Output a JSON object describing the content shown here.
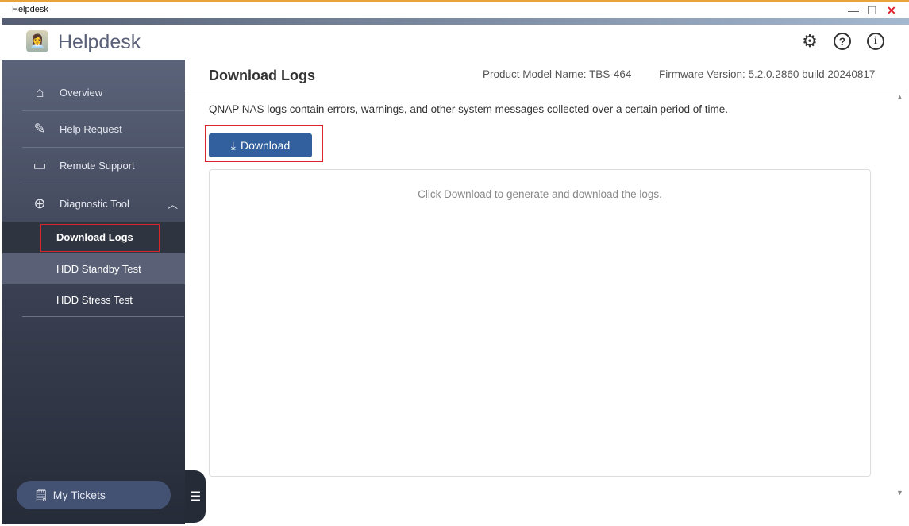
{
  "window": {
    "title": "Helpdesk",
    "minimize": "—",
    "maximize": "☐",
    "close": "✕"
  },
  "header": {
    "app_title": "Helpdesk",
    "settings_icon": "⚙",
    "help_icon": "?",
    "info_icon": "i"
  },
  "sidebar": {
    "items": [
      {
        "label": "Overview",
        "icon": "⌂"
      },
      {
        "label": "Help Request",
        "icon": "✎"
      },
      {
        "label": "Remote Support",
        "icon": "▭"
      },
      {
        "label": "Diagnostic Tool",
        "icon": "⊕",
        "chevron": "︿"
      }
    ],
    "subitems": [
      {
        "label": "Download Logs"
      },
      {
        "label": "HDD Standby Test"
      },
      {
        "label": "HDD Stress Test"
      }
    ],
    "my_tickets": "My Tickets",
    "menu_icon": "☰"
  },
  "main": {
    "title": "Download Logs",
    "product_model": "Product Model Name: TBS-464",
    "firmware": "Firmware Version: 5.2.0.2860 build 20240817",
    "description": "QNAP NAS logs contain errors, warnings, and other system messages collected over a certain period of time.",
    "download_label": "Download",
    "download_icon": "⤓",
    "panel_message": "Click Download to generate and download the logs."
  }
}
